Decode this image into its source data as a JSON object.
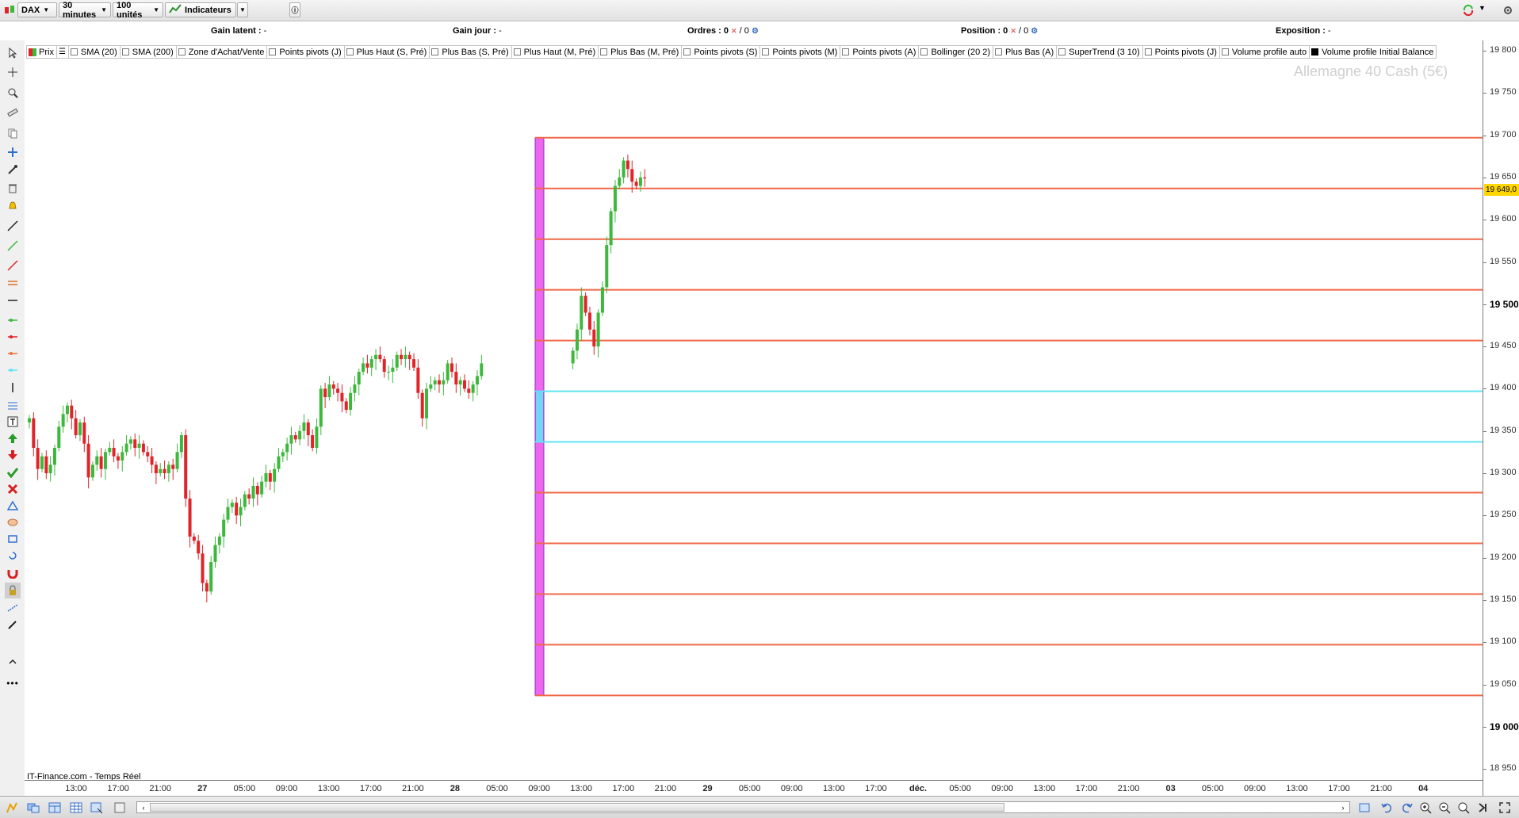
{
  "toolbar": {
    "instrument": "DAX",
    "timeframe": "30 minutes",
    "units": "100 unités",
    "indicators_label": "Indicateurs"
  },
  "infobar": {
    "gain_latent_label": "Gain latent :",
    "gain_latent_value": "-",
    "gain_jour_label": "Gain jour :",
    "gain_jour_value": "-",
    "ordres_label": "Ordres :",
    "ordres_buy": "0",
    "ordres_sell": "/ 0",
    "position_label": "Position :",
    "position_buy": "0",
    "position_sell": "/ 0",
    "exposition_label": "Exposition :",
    "exposition_value": "-"
  },
  "legend": [
    {
      "label": "Prix",
      "checked": true,
      "type": "price"
    },
    {
      "label": "",
      "checked": false,
      "type": "list"
    },
    {
      "label": "SMA (20)",
      "checked": false
    },
    {
      "label": "SMA (200)",
      "checked": false
    },
    {
      "label": "Zone d'Achat/Vente",
      "checked": false
    },
    {
      "label": "Points pivots (J)",
      "checked": false
    },
    {
      "label": "Plus Haut (S, Pré)",
      "checked": false
    },
    {
      "label": "Plus Bas (S, Pré)",
      "checked": false
    },
    {
      "label": "Plus Haut (M, Pré)",
      "checked": false
    },
    {
      "label": "Plus Bas (M, Pré)",
      "checked": false
    },
    {
      "label": "Points pivots (S)",
      "checked": false
    },
    {
      "label": "Points pivots (M)",
      "checked": false
    },
    {
      "label": "Points pivots (A)",
      "checked": false
    },
    {
      "label": "Bollinger (20 2)",
      "checked": false
    },
    {
      "label": "Plus Bas (A)",
      "checked": false
    },
    {
      "label": "SuperTrend (3 10)",
      "checked": false
    },
    {
      "label": "Points pivots (J)",
      "checked": false
    },
    {
      "label": "Volume profile auto",
      "checked": false
    },
    {
      "label": "Volume profile Initial Balance",
      "checked": true
    }
  ],
  "watermark": "Allemagne 40 Cash (5€)",
  "source": "IT-Finance.com - Temps Réel",
  "current_price_label": "19 649,0",
  "colors": {
    "up": "#3cb83c",
    "down": "#e0242a",
    "level_line": "#f06848",
    "ib_line": "#5ee4f2",
    "profile_fill": "#ee66ee",
    "price_badge": "#ffd700"
  },
  "chart_data": {
    "type": "candlestick",
    "y_ticks": [
      {
        "label": "18 950",
        "value": 18950,
        "bold": false
      },
      {
        "label": "19 000",
        "value": 19000,
        "bold": true
      },
      {
        "label": "19 050",
        "value": 19050,
        "bold": false
      },
      {
        "label": "19 100",
        "value": 19100,
        "bold": false
      },
      {
        "label": "19 150",
        "value": 19150,
        "bold": false
      },
      {
        "label": "19 200",
        "value": 19200,
        "bold": false
      },
      {
        "label": "19 250",
        "value": 19250,
        "bold": false
      },
      {
        "label": "19 300",
        "value": 19300,
        "bold": false
      },
      {
        "label": "19 350",
        "value": 19350,
        "bold": false
      },
      {
        "label": "19 400",
        "value": 19400,
        "bold": false
      },
      {
        "label": "19 450",
        "value": 19450,
        "bold": false
      },
      {
        "label": "19 500",
        "value": 19500,
        "bold": true
      },
      {
        "label": "19 550",
        "value": 19550,
        "bold": false
      },
      {
        "label": "19 600",
        "value": 19600,
        "bold": false
      },
      {
        "label": "19 650",
        "value": 19650,
        "bold": false
      },
      {
        "label": "19 700",
        "value": 19700,
        "bold": false
      },
      {
        "label": "19 750",
        "value": 19750,
        "bold": false
      },
      {
        "label": "19 800",
        "value": 19800,
        "bold": false
      }
    ],
    "x_ticks": [
      {
        "label": "13:00",
        "bold": false
      },
      {
        "label": "17:00",
        "bold": false
      },
      {
        "label": "21:00",
        "bold": false
      },
      {
        "label": "27",
        "bold": true
      },
      {
        "label": "05:00",
        "bold": false
      },
      {
        "label": "09:00",
        "bold": false
      },
      {
        "label": "13:00",
        "bold": false
      },
      {
        "label": "17:00",
        "bold": false
      },
      {
        "label": "21:00",
        "bold": false
      },
      {
        "label": "28",
        "bold": true
      },
      {
        "label": "05:00",
        "bold": false
      },
      {
        "label": "09:00",
        "bold": false
      },
      {
        "label": "13:00",
        "bold": false
      },
      {
        "label": "17:00",
        "bold": false
      },
      {
        "label": "21:00",
        "bold": false
      },
      {
        "label": "29",
        "bold": true
      },
      {
        "label": "05:00",
        "bold": false
      },
      {
        "label": "09:00",
        "bold": false
      },
      {
        "label": "13:00",
        "bold": false
      },
      {
        "label": "17:00",
        "bold": false
      },
      {
        "label": "déc.",
        "bold": true
      },
      {
        "label": "05:00",
        "bold": false
      },
      {
        "label": "09:00",
        "bold": false
      },
      {
        "label": "13:00",
        "bold": false
      },
      {
        "label": "17:00",
        "bold": false
      },
      {
        "label": "21:00",
        "bold": false
      },
      {
        "label": "03",
        "bold": true
      },
      {
        "label": "05:00",
        "bold": false
      },
      {
        "label": "09:00",
        "bold": false
      },
      {
        "label": "13:00",
        "bold": false
      },
      {
        "label": "17:00",
        "bold": false
      },
      {
        "label": "21:00",
        "bold": false
      },
      {
        "label": "04",
        "bold": true
      }
    ],
    "level_lines": [
      19697,
      19637,
      19577,
      19517,
      19457,
      19277,
      19217,
      19157,
      19097,
      19037
    ],
    "initial_balance_lines": [
      19397,
      19337
    ],
    "profile_range": [
      19037,
      19697
    ],
    "candles_close": [
      19365,
      19330,
      19305,
      19320,
      19300,
      19310,
      19330,
      19355,
      19370,
      19380,
      19365,
      19345,
      19360,
      19335,
      19295,
      19310,
      19320,
      19305,
      19325,
      19330,
      19320,
      19315,
      19325,
      19335,
      19340,
      19330,
      19335,
      19325,
      19320,
      19310,
      19300,
      19305,
      19300,
      19310,
      19305,
      19325,
      19345,
      19270,
      19225,
      19220,
      19205,
      19170,
      19160,
      19195,
      19215,
      19225,
      19245,
      19260,
      19265,
      19250,
      19260,
      19275,
      19270,
      19285,
      19275,
      19290,
      19300,
      19290,
      19305,
      19320,
      19325,
      19335,
      19345,
      19340,
      19350,
      19360,
      19345,
      19330,
      19355,
      19400,
      19390,
      19405,
      19400,
      19395,
      19385,
      19375,
      19395,
      19405,
      19420,
      19430,
      19425,
      19435,
      19440,
      19435,
      19420,
      19420,
      19425,
      19440,
      19435,
      19440,
      19435,
      19425,
      19395,
      19365,
      19400,
      19405,
      19410,
      19405,
      19410,
      19430,
      19420,
      19405,
      19410,
      19400,
      19395,
      19405,
      19415,
      19430,
      19445,
      19470,
      19510,
      19490,
      19470,
      19450,
      19490,
      19520,
      19570,
      19610,
      19640,
      19650,
      19670,
      19660,
      19645,
      19640,
      19650,
      19649
    ]
  },
  "bottombar": {
    "scroll_left": "‹",
    "scroll_right": "›"
  }
}
